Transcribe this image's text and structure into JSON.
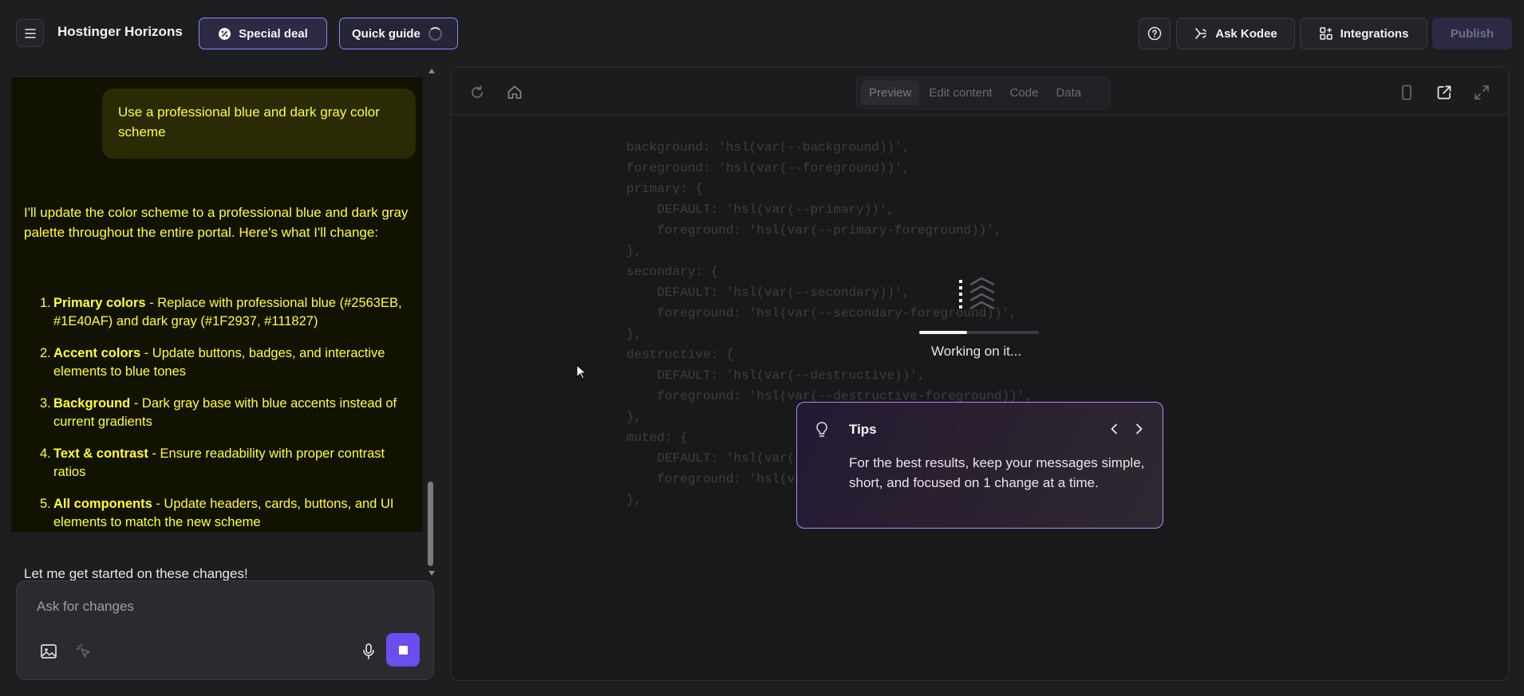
{
  "header": {
    "app_title": "Hostinger Horizons",
    "special_deal_label": "Special deal",
    "quick_guide_label": "Quick guide",
    "ask_kodee_label": "Ask Kodee",
    "integrations_label": "Integrations",
    "publish_label": "Publish"
  },
  "chat": {
    "user_message": "Use a professional blue and dark gray color scheme",
    "assistant_intro": "I'll update the color scheme to a professional blue and dark gray palette throughout the entire portal. Here's what I'll change:",
    "changes": [
      {
        "num": "1.",
        "title": "Primary colors",
        "desc": " - Replace with professional blue (#2563EB, #1E40AF) and dark gray (#1F2937, #111827)"
      },
      {
        "num": "2.",
        "title": "Accent colors",
        "desc": " - Update buttons, badges, and interactive elements to blue tones"
      },
      {
        "num": "3.",
        "title": "Background",
        "desc": " - Dark gray base with blue accents instead of current gradients"
      },
      {
        "num": "4.",
        "title": "Text & contrast",
        "desc": " - Ensure readability with proper contrast ratios"
      },
      {
        "num": "5.",
        "title": "All components",
        "desc": " - Update headers, cards, buttons, and UI elements to match the new scheme"
      }
    ],
    "outro": "Let me get started on these changes!",
    "input_placeholder": "Ask for changes"
  },
  "preview": {
    "tabs": [
      "Preview",
      "Edit content",
      "Code",
      "Data"
    ],
    "active_tab": "Preview",
    "status_text": "Working on it...",
    "progress": 0.4,
    "code_lines": [
      "background: 'hsl(var(--background))',",
      "foreground: 'hsl(var(--foreground))',",
      "primary: {",
      "    DEFAULT: 'hsl(var(--primary))',",
      "    foreground: 'hsl(var(--primary-foreground))',",
      "},",
      "secondary: {",
      "    DEFAULT: 'hsl(var(--secondary))',",
      "    foreground: 'hsl(var(--secondary-foreground))',",
      "},",
      "destructive: {",
      "    DEFAULT: 'hsl(var(--destructive))',",
      "    foreground: 'hsl(var(--destructive-foreground))',",
      "},",
      "muted: {",
      "    DEFAULT: 'hsl(var(--muted))',",
      "    foreground: 'hsl(var(--muted-foreground))',",
      "},"
    ]
  },
  "tips": {
    "title": "Tips",
    "body": "For the best results, keep your messages simple, short, and focused on 1 change at a time."
  },
  "colors": {
    "accent": "#6c4df0",
    "highlight_text": "#ffff3a",
    "tips_border": "#b986ff"
  },
  "icons": [
    "menu-icon",
    "special-deal-icon",
    "help-icon",
    "kodee-icon",
    "integrations-icon",
    "refresh-icon",
    "home-icon",
    "mobile-icon",
    "open-external-icon",
    "fullscreen-icon",
    "image-icon",
    "cursor-select-icon",
    "microphone-icon",
    "stop-icon",
    "lightbulb-icon",
    "chevron-left-icon",
    "chevron-right-icon"
  ]
}
